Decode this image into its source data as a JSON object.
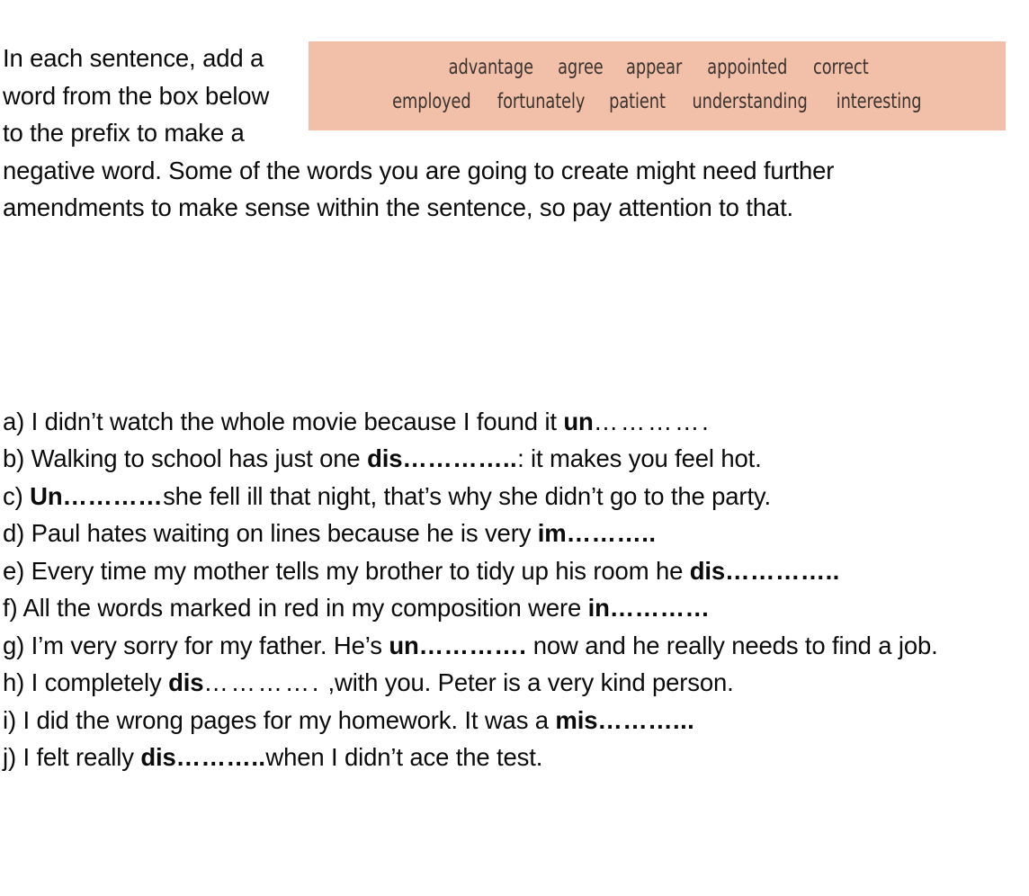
{
  "document": {
    "title": "Negative Prefixes Worksheet",
    "background_color": "#ffffff",
    "text_color": "#0b0b0b"
  },
  "instructions": {
    "part_1": "In each sentence,",
    "part_2": "add a word from the",
    "part_3": "box below to the",
    "part_4": "prefix to make a negative word. Some of the words you are going to create might need further amendments to make sense within the sentence, so pay attention to that."
  },
  "word_bank": {
    "background_color": "#f2c0a8",
    "text_color": "#3b3330",
    "row_1": [
      "advantage",
      "agree",
      "appear",
      "appointed",
      "correct"
    ],
    "row_2": [
      "employed",
      "fortunately",
      "patient",
      "understanding",
      "interesting"
    ]
  },
  "exercises": [
    {
      "marker": "a)",
      "before": " I didn’t watch the whole movie because I found it ",
      "prefix": "un",
      "dots": "………….",
      "dots_style": "thin",
      "after": ""
    },
    {
      "marker": "b)",
      "before": " Walking to school has just one ",
      "prefix": "dis",
      "dots": "…………..",
      "dots_style": "bold",
      "after": ": it makes you feel hot."
    },
    {
      "marker": "c)",
      "before": " ",
      "prefix": "Un",
      "dots": "…………",
      "dots_style": "bold",
      "after": "she fell ill that night, that’s why she didn’t go to the party."
    },
    {
      "marker": "d)",
      "before": " Paul hates waiting on lines because he is very ",
      "prefix": "im",
      "dots": "………..",
      "dots_style": "bold",
      "after": ""
    },
    {
      "marker": "e)",
      "before": " Every time my mother tells my brother to tidy up his room he ",
      "prefix": "dis",
      "dots": "…………..",
      "dots_style": "bold",
      "after": ""
    },
    {
      "marker": "f)",
      "before": " All the words marked in red in my composition were ",
      "prefix": "in",
      "dots": "…………",
      "dots_style": "bold",
      "after": ""
    },
    {
      "marker": "g)",
      "before": " I’m very sorry for my father. He’s ",
      "prefix": "un",
      "dots": "………….",
      "dots_style": "bold",
      "after": " now and he really needs to find a job."
    },
    {
      "marker": "h)",
      "before": " I completely ",
      "prefix": "dis",
      "dots": "………….",
      "dots_style": "thin",
      "after": " ,with you. Peter is a very kind person."
    },
    {
      "marker": "i)",
      "before": " I did the wrong pages for my homework. It was a ",
      "prefix": "mis",
      "dots": "………...",
      "dots_style": "bold",
      "after": ""
    },
    {
      "marker": "j)",
      "before": " I felt really ",
      "prefix": "dis",
      "dots": "………..",
      "dots_style": "bold",
      "after": "when I didn’t ace the test."
    }
  ]
}
